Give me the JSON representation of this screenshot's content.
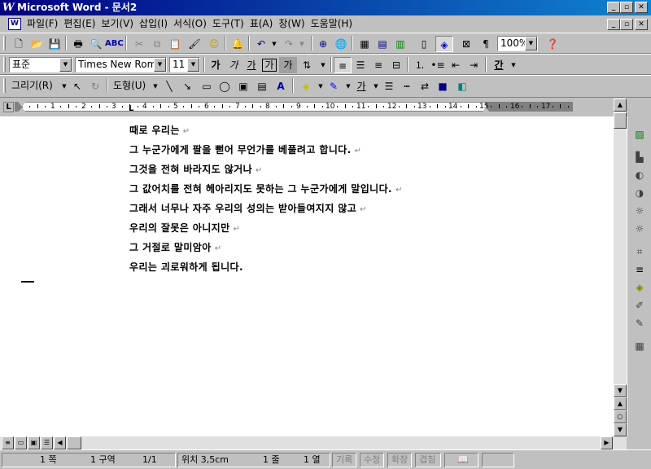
{
  "titlebar": {
    "app_icon": "W",
    "title": "Microsoft Word - 문서2"
  },
  "window_controls": {
    "minimize": "_",
    "restore": "▫",
    "close": "✕"
  },
  "menu": {
    "items": [
      "파일(F)",
      "편집(E)",
      "보기(V)",
      "삽입(I)",
      "서식(O)",
      "도구(T)",
      "표(A)",
      "창(W)",
      "도움말(H)"
    ]
  },
  "standard_toolbar": {
    "zoom": "100%",
    "icons": [
      "new-icon",
      "open-icon",
      "save-icon",
      "print-icon",
      "print-preview-icon",
      "spelling-icon",
      "cut-icon",
      "copy-icon",
      "paste-icon",
      "format-painter-icon",
      "smiley-icon",
      "bell-icon",
      "undo-icon",
      "redo-icon",
      "web-icon",
      "globe-icon",
      "table-icon",
      "insert-table-icon",
      "excel-icon",
      "columns-icon",
      "drawing-icon",
      "map-icon",
      "show-hide-icon",
      "help-icon"
    ]
  },
  "formatting_toolbar": {
    "style": "표준",
    "font": "Times New Rom",
    "size": "11",
    "bold": "가",
    "italic": "가",
    "underline": "가",
    "char_border": "가",
    "char_shading": "가",
    "font_color_label": "간"
  },
  "drawing_toolbar": {
    "draw_menu": "그리기(R)",
    "autoshape_menu": "도형(U)",
    "font_color_label": "가"
  },
  "ruler": {
    "numbers": [
      "1",
      "2",
      "3",
      "4",
      "5",
      "6",
      "7",
      "8",
      "9",
      "10",
      "11",
      "12",
      "13",
      "14",
      "15",
      "16",
      "17"
    ],
    "tab_marker": "L"
  },
  "document": {
    "lines": [
      "때로 우리는",
      "그 누군가에게 팔을 뻗어 무언가를 베풀려고 합니다.",
      "그것을 전혀 바라지도 않거나",
      "그 값어치를 전혀 헤아리지도 못하는 그 누군가에게 말입니다.",
      "그래서 너무나 자주 우리의 성의는 받아들여지지 않고",
      "우리의 잘못은 아니지만",
      "그 거절로 말미암아",
      "우리는 괴로워하게 됩니다."
    ],
    "paragraph_mark": "↵"
  },
  "statusbar": {
    "page": "1 쪽",
    "section": "1 구역",
    "page_of": "1/1",
    "position": "위치 3,5cm",
    "line": "1 줄",
    "column": "1 열",
    "rec": "기록",
    "trk": "수정",
    "ext": "확장",
    "ovr": "겹침"
  }
}
